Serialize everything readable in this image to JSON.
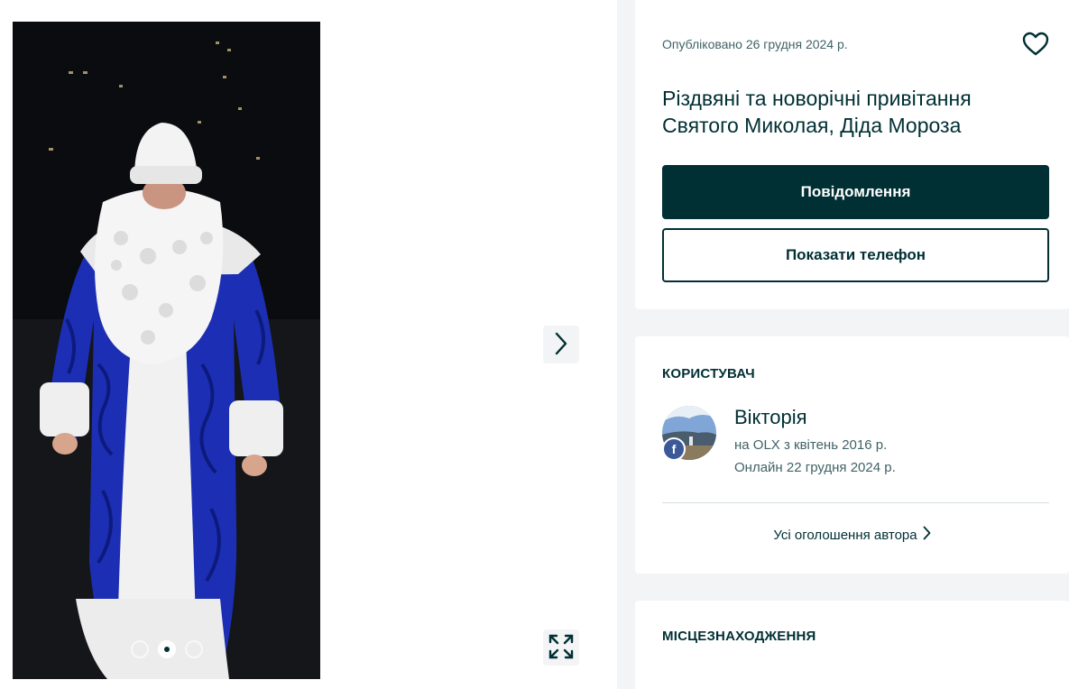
{
  "gallery": {
    "next_icon": "chevron-right-icon",
    "expand_icon": "expand-icon",
    "dots": [
      {
        "active": false
      },
      {
        "active": true
      },
      {
        "active": false
      }
    ]
  },
  "listing": {
    "published": "Опубліковано 26 грудня 2024 р.",
    "title": "Різдвяні та новорічні привітання Святого Миколая, Діда Мороза",
    "favorite_icon": "heart-icon",
    "message_button": "Повідомлення",
    "phone_button": "Показати телефон"
  },
  "user": {
    "heading": "КОРИСТУВАЧ",
    "name": "Вікторія",
    "since": "на OLX з квітень 2016 р.",
    "online": "Онлайн 22 грудня 2024 р.",
    "badge_icon": "facebook-icon",
    "all_ads": "Усі оголошення автора"
  },
  "location": {
    "heading": "МІСЦЕЗНАХОДЖЕННЯ"
  },
  "colors": {
    "primary": "#002f34",
    "background": "#f2f4f5",
    "facebook": "#3b5998"
  }
}
